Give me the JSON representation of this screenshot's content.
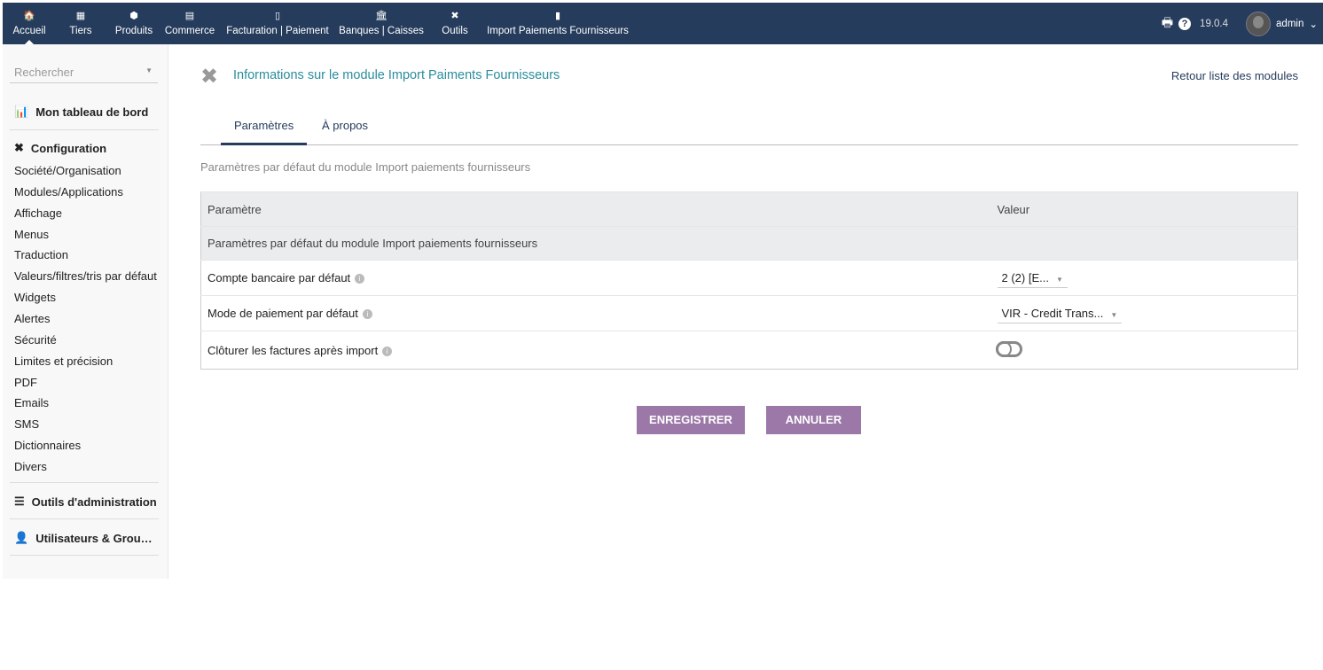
{
  "topbar": {
    "menus": [
      {
        "label": "Accueil",
        "icon": "🏠"
      },
      {
        "label": "Tiers",
        "icon": "▦"
      },
      {
        "label": "Produits",
        "icon": "⬢"
      },
      {
        "label": "Commerce",
        "icon": "▤"
      },
      {
        "label": "Facturation | Paiement",
        "icon": "▯"
      },
      {
        "label": "Banques | Caisses",
        "icon": "🏛"
      },
      {
        "label": "Outils",
        "icon": "✖"
      },
      {
        "label": "Import Paiements Fournisseurs",
        "icon": "▮"
      }
    ],
    "version": "19.0.4",
    "user": "admin"
  },
  "sidebar": {
    "search_placeholder": "Rechercher",
    "dashboard": "Mon tableau de bord",
    "config": "Configuration",
    "items": [
      "Société/Organisation",
      "Modules/Applications",
      "Affichage",
      "Menus",
      "Traduction",
      "Valeurs/filtres/tris par défaut",
      "Widgets",
      "Alertes",
      "Sécurité",
      "Limites et précision",
      "PDF",
      "Emails",
      "SMS",
      "Dictionnaires",
      "Divers"
    ],
    "admin_tools": "Outils d'administration",
    "users": "Utilisateurs & Groupes"
  },
  "main": {
    "title": "Informations sur le module Import Paiments Fournisseurs",
    "back": "Retour liste des modules",
    "tabs": [
      "Paramètres",
      "À propos"
    ],
    "subtitle": "Paramètres par défaut du module Import paiements fournisseurs",
    "table": {
      "col_param": "Paramètre",
      "col_value": "Valeur",
      "group": "Paramètres par défaut du module Import paiements fournisseurs",
      "rows": [
        {
          "label": "Compte bancaire par défaut",
          "value": "2 (2) [E..."
        },
        {
          "label": "Mode de paiement par défaut",
          "value": "VIR - Credit Trans..."
        },
        {
          "label": "Clôturer les factures après import",
          "value": false
        }
      ]
    },
    "save": "ENREGISTRER",
    "cancel": "ANNULER"
  }
}
